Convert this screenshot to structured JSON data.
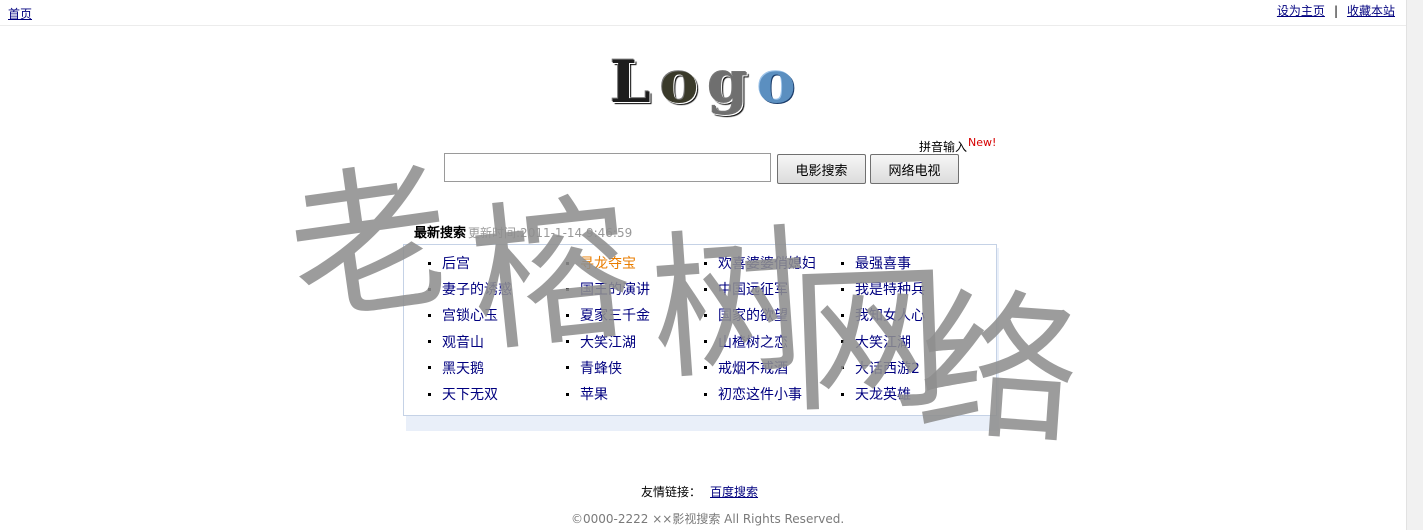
{
  "topbar": {
    "home": "首页",
    "set_home": "设为主页",
    "separator": "|",
    "bookmark": "收藏本站"
  },
  "logo": {
    "text": [
      "L",
      "o",
      "g",
      "o"
    ]
  },
  "search": {
    "pinyin_label": "拼音输入",
    "new_badge": "New!",
    "input_value": "",
    "movie_button": "电影搜索",
    "tv_button": "网络电视"
  },
  "latest": {
    "title": "最新搜索",
    "update_time": "更新时间:2011-1-14 9:46:59",
    "items": [
      {
        "label": "后宫",
        "hot": false
      },
      {
        "label": "寻龙夺宝",
        "hot": true
      },
      {
        "label": "欢喜婆婆俏媳妇",
        "hot": false
      },
      {
        "label": "最强喜事",
        "hot": false
      },
      {
        "label": "妻子的诱惑",
        "hot": false
      },
      {
        "label": "国王的演讲",
        "hot": false
      },
      {
        "label": "中国远征军",
        "hot": false
      },
      {
        "label": "我是特种兵",
        "hot": false
      },
      {
        "label": "宫锁心玉",
        "hot": false
      },
      {
        "label": "夏家三千金",
        "hot": false
      },
      {
        "label": "国家的欲望",
        "hot": false
      },
      {
        "label": "我知女人心",
        "hot": false
      },
      {
        "label": "观音山",
        "hot": false
      },
      {
        "label": "大笑江湖",
        "hot": false
      },
      {
        "label": "山楂树之恋",
        "hot": false
      },
      {
        "label": "大笑江湖",
        "hot": false
      },
      {
        "label": "黑天鹅",
        "hot": false
      },
      {
        "label": "青蜂侠",
        "hot": false
      },
      {
        "label": "戒烟不戒酒",
        "hot": false
      },
      {
        "label": "大话西游2",
        "hot": false
      },
      {
        "label": "天下无双",
        "hot": false
      },
      {
        "label": "苹果",
        "hot": false
      },
      {
        "label": "初恋这件小事",
        "hot": false
      },
      {
        "label": "天龙英雄",
        "hot": false
      }
    ]
  },
  "watermark": {
    "chars": [
      "老",
      "榕",
      "树",
      "网",
      "络"
    ]
  },
  "footer": {
    "friends_label": "友情链接：",
    "friend_link": "百度搜索",
    "copyright": "©0000-2222 ××影视搜索  All Rights Reserved."
  },
  "colors": {
    "link": "#00007f",
    "hot": "#e97d00",
    "new_badge": "#d60000"
  }
}
